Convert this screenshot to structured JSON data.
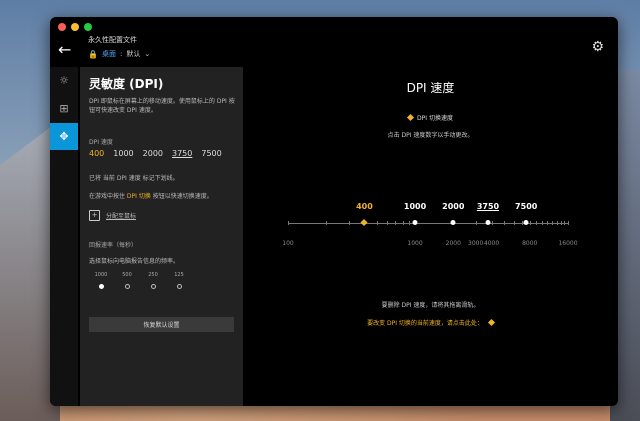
{
  "app": {
    "profile_title": "永久性配置文件",
    "profile_link": "桌面",
    "profile_sep": ":",
    "profile_value": "默认",
    "colors": {
      "accent": "#0a96d8",
      "highlight": "#f0b429",
      "link": "#4aa8ff"
    }
  },
  "rail": {
    "items": [
      {
        "icon": "sun-icon"
      },
      {
        "icon": "plus-square-icon"
      },
      {
        "icon": "move-arrows-icon",
        "active": true
      }
    ]
  },
  "panel": {
    "title": "灵敏度 (DPI)",
    "description": "DPI 即鼠标在屏幕上的移动速度。使用鼠标上的 DPI 按钮可快速改变 DPI 速度。",
    "dpi_label": "DPI 速度",
    "dpi_values": [
      "400",
      "1000",
      "2000",
      "3750",
      "7500"
    ],
    "dpi_selected": "400",
    "dpi_underlined": "3750",
    "marked_text": "已将 当前 DPI 速度 标记下划线。",
    "game_text_pre": "在游戏中按住 ",
    "game_text_hl": "DPI 切换",
    "game_text_post": " 按钮以快速切换速度。",
    "assign_label": "分配至鼠标",
    "rate_label": "回报速率（每秒）",
    "rate_desc": "选择鼠标向电脑报告信息的频率。",
    "rates": [
      "1000",
      "500",
      "250",
      "125"
    ],
    "rate_selected": "1000",
    "reset_label": "恢复默认设置"
  },
  "main": {
    "title": "DPI 速度",
    "legend": "DPI 切换速度",
    "hint": "点击 DPI 速度数字以手动更改。",
    "slider": {
      "points": [
        {
          "value": "400"
        },
        {
          "value": "1000"
        },
        {
          "value": "2000"
        },
        {
          "value": "3750"
        },
        {
          "value": "7500"
        }
      ],
      "current": "400",
      "axis": [
        "100",
        "1000",
        "2000",
        "3000",
        "4000",
        "8000",
        "16000"
      ]
    },
    "remove_hint": "要删除 DPI 速度，请将其拖离滑轨。",
    "change_hint": "要改变 DPI 切换的当前速度，请点击此处："
  }
}
